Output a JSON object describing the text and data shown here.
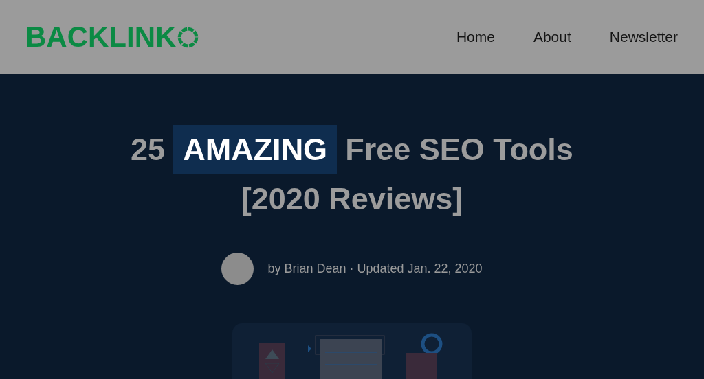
{
  "header": {
    "logo": "BACKLINK",
    "nav": [
      "Home",
      "About",
      "Newsletter"
    ]
  },
  "title_lines": [
    [
      {
        "text": "25",
        "highlighted": false
      },
      {
        "text": "AMAZING",
        "highlighted": true
      },
      {
        "text": "Free SEO Tools",
        "highlighted": false
      }
    ],
    [
      {
        "text": "[2020 Reviews]",
        "highlighted": false
      }
    ]
  ],
  "byline": "by Brian Dean · Updated Jan. 22, 2020"
}
